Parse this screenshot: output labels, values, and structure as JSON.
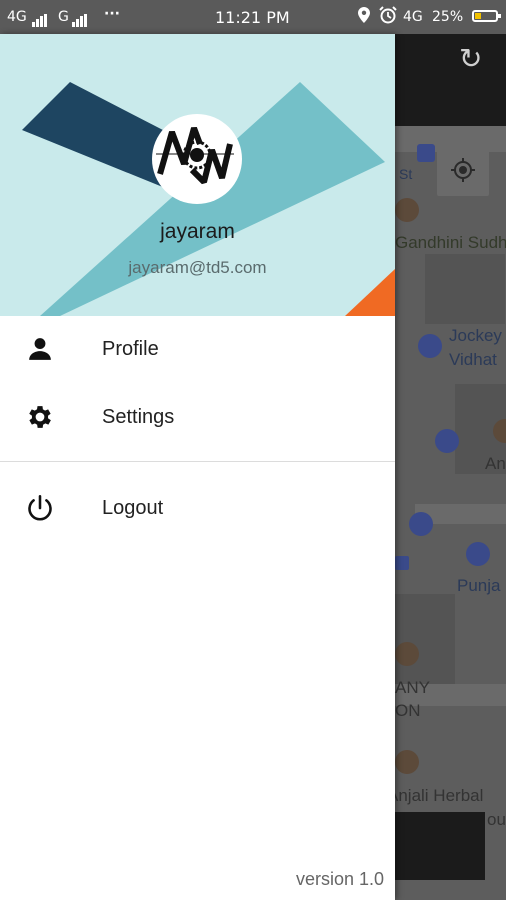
{
  "status_bar": {
    "network1": "4G",
    "network2": "G",
    "more": "···",
    "time": "11:21 PM",
    "network3": "4G",
    "battery": "25%",
    "battery_level": 0.25
  },
  "drawer": {
    "header": {
      "username": "jayaram",
      "email": "jayaram@td5.com",
      "colors": {
        "background": "#c9eaeb",
        "dark_band": "#1e4561",
        "teal_band": "#74c0c8",
        "accent": "#f06a23"
      }
    },
    "menu": [
      {
        "label": "Profile",
        "icon": "person-icon"
      },
      {
        "label": "Settings",
        "icon": "gear-icon"
      },
      {
        "label": "Logout",
        "icon": "power-icon"
      }
    ],
    "version": "version 1.0"
  },
  "map": {
    "labels": [
      "Gandhini Sudh",
      "Jockey",
      "Vidhat",
      "An",
      "Punja",
      "ANY",
      "ON",
      "Anjali Herbal",
      "ou",
      "St"
    ]
  }
}
